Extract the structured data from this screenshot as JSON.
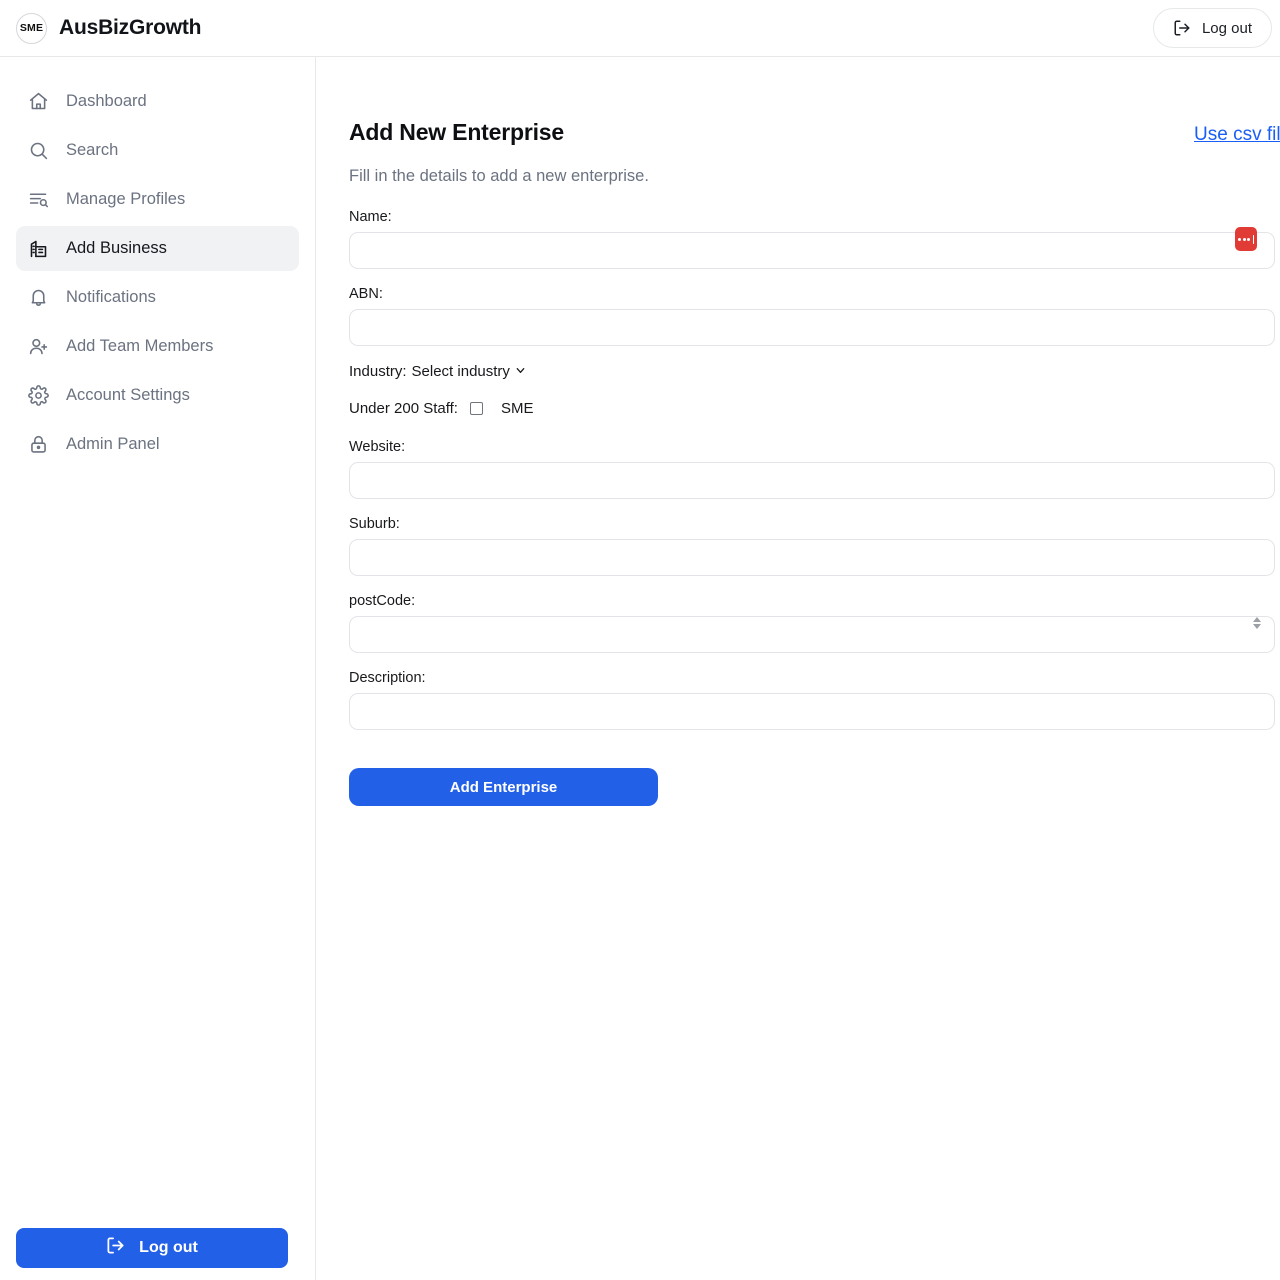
{
  "header": {
    "logo_text": "SME",
    "brand_title": "AusBizGrowth",
    "logout_label": "Log out"
  },
  "sidebar": {
    "items": [
      {
        "label": "Dashboard",
        "icon": "home-icon",
        "active": false
      },
      {
        "label": "Search",
        "icon": "search-icon",
        "active": false
      },
      {
        "label": "Manage Profiles",
        "icon": "list-search-icon",
        "active": false
      },
      {
        "label": "Add Business",
        "icon": "building-icon",
        "active": true
      },
      {
        "label": "Notifications",
        "icon": "bell-icon",
        "active": false
      },
      {
        "label": "Add Team Members",
        "icon": "user-plus-icon",
        "active": false
      },
      {
        "label": "Account Settings",
        "icon": "gear-icon",
        "active": false
      },
      {
        "label": "Admin Panel",
        "icon": "lock-icon",
        "active": false
      }
    ],
    "logout_label": "Log out"
  },
  "main": {
    "title": "Add New Enterprise",
    "csv_link": "Use csv file...",
    "subtitle": "Fill in the details to add a new enterprise.",
    "fields": {
      "name_label": "Name:",
      "name_value": "",
      "abn_label": "ABN:",
      "abn_value": "",
      "industry_label": "Industry:",
      "industry_selected": "Select industry",
      "staff_label": "Under 200 Staff:",
      "staff_checkbox_text": "SME",
      "staff_checked": false,
      "website_label": "Website:",
      "website_value": "",
      "suburb_label": "Suburb:",
      "suburb_value": "",
      "postcode_label": "postCode:",
      "postcode_value": "",
      "description_label": "Description:",
      "description_value": ""
    },
    "submit_label": "Add Enterprise"
  },
  "colors": {
    "accent_blue": "#2360e8",
    "link_blue": "#1a5ef5",
    "badge_red": "#e03b35",
    "active_bg": "#f1f2f4",
    "border": "#e7e8ea"
  }
}
